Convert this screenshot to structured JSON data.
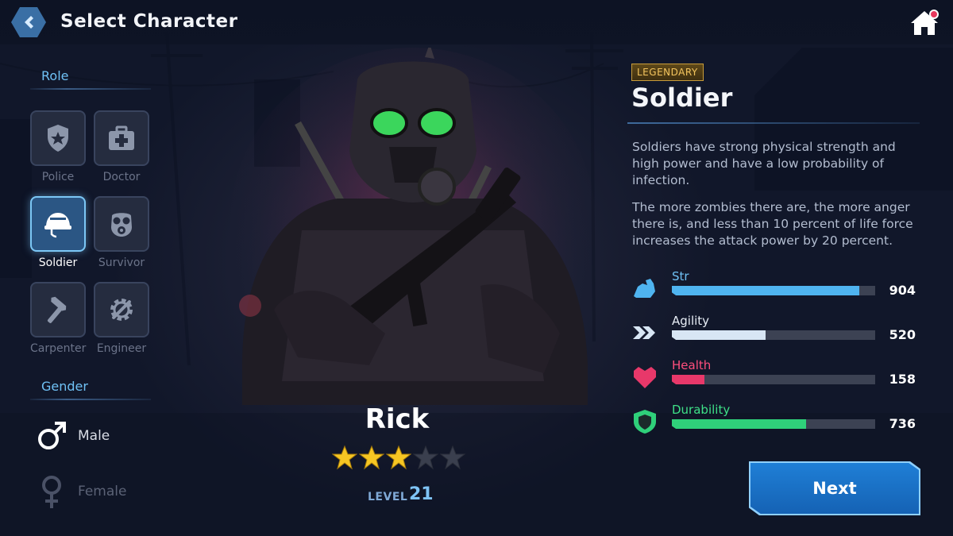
{
  "header": {
    "title": "Select Character",
    "back_icon": "chevron-left-icon",
    "home_icon": "home-icon"
  },
  "roles": {
    "section_label": "Role",
    "items": [
      {
        "label": "Police",
        "icon": "police-badge-icon",
        "selected": false
      },
      {
        "label": "Doctor",
        "icon": "medical-kit-icon",
        "selected": false
      },
      {
        "label": "Soldier",
        "icon": "helmet-icon",
        "selected": true
      },
      {
        "label": "Survivor",
        "icon": "gas-mask-icon",
        "selected": false
      },
      {
        "label": "Carpenter",
        "icon": "hammer-icon",
        "selected": false
      },
      {
        "label": "Engineer",
        "icon": "gear-wrench-icon",
        "selected": false
      }
    ]
  },
  "gender": {
    "section_label": "Gender",
    "options": [
      {
        "label": "Male",
        "icon": "male-symbol-icon",
        "selected": true
      },
      {
        "label": "Female",
        "icon": "female-symbol-icon",
        "selected": false
      }
    ]
  },
  "character": {
    "name": "Rick",
    "stars_filled": 3,
    "stars_total": 5,
    "level_label": "LEVEL",
    "level": "21"
  },
  "details": {
    "rarity": "LEGENDARY",
    "class_name": "Soldier",
    "description_1": "Soldiers have strong physical strength and high power and have a low probability of infection.",
    "description_2": "The more zombies there are, the more anger there is, and less than 10 percent of life force increases the attack power by 20 percent.",
    "stats": [
      {
        "label": "Str",
        "value": "904",
        "fill": 0.92,
        "color": "#4fb4f0",
        "label_color": "#6fc1f5",
        "icon": "strength-arm-icon"
      },
      {
        "label": "Agility",
        "value": "520",
        "fill": 0.46,
        "color": "#d8e6f4",
        "label_color": "#e8eef6",
        "icon": "double-chevron-icon"
      },
      {
        "label": "Health",
        "value": "158",
        "fill": 0.16,
        "color": "#e8386a",
        "label_color": "#ff4f7d",
        "icon": "heart-icon"
      },
      {
        "label": "Durability",
        "value": "736",
        "fill": 0.66,
        "color": "#2fd07a",
        "label_color": "#3ee087",
        "icon": "shield-icon"
      }
    ]
  },
  "actions": {
    "next_label": "Next"
  }
}
